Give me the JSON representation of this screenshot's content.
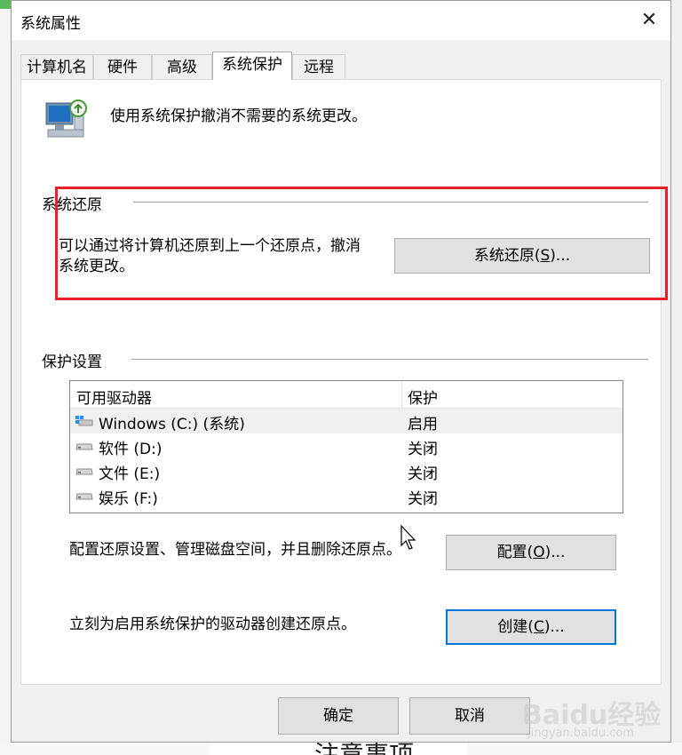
{
  "window": {
    "title": "系统属性",
    "close_glyph": "✕"
  },
  "tabs": [
    {
      "label": "计算机名",
      "active": false
    },
    {
      "label": "硬件",
      "active": false
    },
    {
      "label": "高级",
      "active": false
    },
    {
      "label": "系统保护",
      "active": true
    },
    {
      "label": "远程",
      "active": false
    }
  ],
  "intro": {
    "text": "使用系统保护撤消不需要的系统更改。",
    "icon": "system-protection-icon"
  },
  "system_restore": {
    "group_title": "系统还原",
    "description": "可以通过将计算机还原到上一个还原点，撤消系统更改。",
    "button_text": "系统还原(",
    "button_key": "S",
    "button_suffix": ")..."
  },
  "protection_settings": {
    "group_title": "保护设置",
    "columns": [
      "可用驱动器",
      "保护"
    ],
    "drives": [
      {
        "name": "Windows  (C:) (系统)",
        "protection": "启用",
        "icon": "windows-drive-icon"
      },
      {
        "name": "软件 (D:)",
        "protection": "关闭",
        "icon": "drive-icon"
      },
      {
        "name": "文件 (E:)",
        "protection": "关闭",
        "icon": "drive-icon"
      },
      {
        "name": "娱乐 (F:)",
        "protection": "关闭",
        "icon": "drive-icon"
      }
    ]
  },
  "configure": {
    "text": "配置还原设置、管理磁盘空间，并且删除还原点。",
    "button_text": "配置(",
    "button_key": "O",
    "button_suffix": ")..."
  },
  "create": {
    "text": "立刻为启用系统保护的驱动器创建还原点。",
    "button_text": "创建(",
    "button_key": "C",
    "button_suffix": ")..."
  },
  "footer": {
    "ok_label": "确定",
    "cancel_label": "取消"
  },
  "background": {
    "bottom_text": "注意事项"
  },
  "watermark": {
    "brand": "Baidu经验",
    "url": "jingyan.baidu.com"
  },
  "colors": {
    "highlight_box": "#e8202a",
    "default_button_border": "#0078d7",
    "button_face": "#e1e1e1"
  }
}
